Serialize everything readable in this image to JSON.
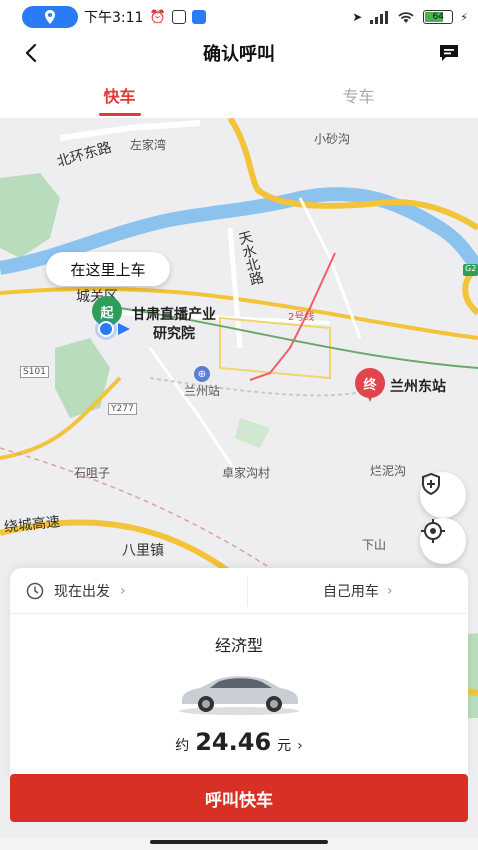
{
  "status": {
    "time": "下午3:11",
    "battery": "64"
  },
  "header": {
    "title": "确认呼叫"
  },
  "tabs": [
    {
      "label": "快车",
      "active": true
    },
    {
      "label": "专车",
      "active": false
    }
  ],
  "map": {
    "labels": {
      "beihuan_road": "北环东路",
      "zuojiawan": "左家湾",
      "xiaoshagou": "小砂沟",
      "tianshui_north": "天水北路",
      "cheng_qu": "城关区",
      "metro_line": "2号线",
      "lanzhou_station": "兰州站",
      "s101": "S101",
      "y277": "Y277",
      "shijuzi": "石咀子",
      "zhuojiagou": "卓家沟村",
      "lanni_gou": "烂泥沟",
      "raocheng": "绕城高速",
      "bali_town": "八里镇",
      "xiashan": "下山",
      "g_marker": "G2"
    },
    "pickup_bubble": "在这里上车",
    "start_marker": "起",
    "start_poi": "甘肃直播产业\n研究院",
    "end_marker": "终",
    "end_poi": "兰州东站"
  },
  "panel": {
    "depart_label": "现在出发",
    "rider_label": "自己用车",
    "car_type": "经济型",
    "price_prefix": "约",
    "price_amount": "24.46",
    "price_unit": "元"
  },
  "call_button": "呼叫快车",
  "colors": {
    "accent": "#e53935",
    "cta": "#d93025",
    "pickup_green": "#2e9e5b",
    "end_red": "#e0454b",
    "road_yellow": "#f3c43a"
  }
}
